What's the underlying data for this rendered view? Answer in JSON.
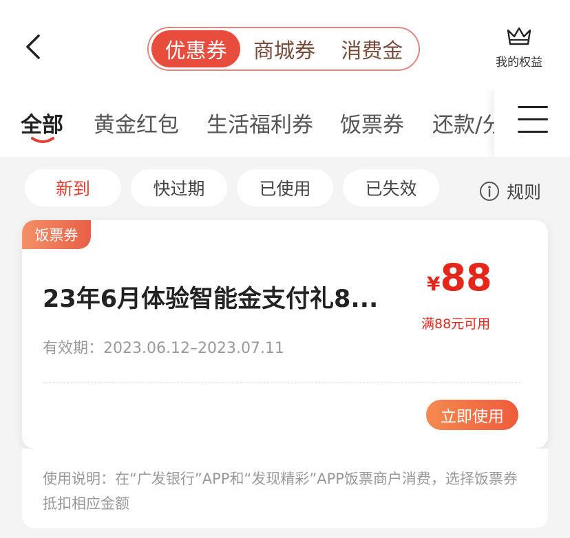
{
  "header": {
    "segments": [
      "优惠券",
      "商城券",
      "消费金"
    ],
    "active_segment": "优惠券",
    "rights_label": "我的权益"
  },
  "tabs": {
    "items": [
      "全部",
      "黄金红包",
      "生活福利券",
      "饭票券",
      "还款/分"
    ],
    "active": "全部"
  },
  "filters": {
    "chips": [
      "新到",
      "快过期",
      "已使用",
      "已失效"
    ],
    "active": "新到",
    "rules_label": "规则"
  },
  "coupon": {
    "tag": "饭票券",
    "title": "23年6月体验智能金支付礼8...",
    "validity": "有效期：2023.06.12–2023.07.11",
    "currency_symbol": "¥",
    "amount": "88",
    "condition": "满88元可用",
    "use_button": "立即使用",
    "description": "使用说明：在“广发银行”APP和“发现精彩”APP饭票商户消费，选择饭票券抵扣相应金额"
  },
  "colors": {
    "accent": "#e84c3d",
    "price": "#e5261a",
    "button": "#f0643f"
  }
}
